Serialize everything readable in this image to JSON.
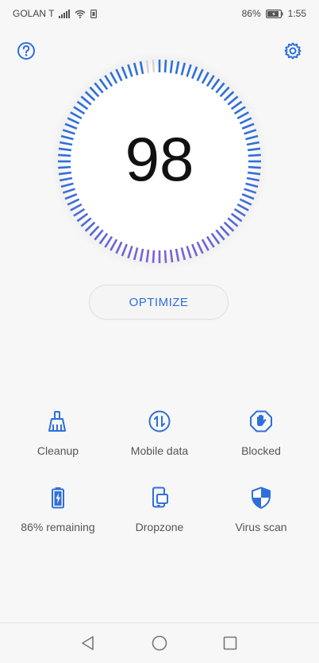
{
  "status_bar": {
    "carrier": "GOLAN T",
    "battery_percent": "86%",
    "time": "1:55"
  },
  "header": {
    "help_icon": "help-circle-icon",
    "settings_icon": "gear-icon"
  },
  "dial": {
    "score": "98",
    "level": 0.98
  },
  "optimize_label": "OPTIMIZE",
  "tools": [
    {
      "label": "Cleanup",
      "icon": "broom-icon"
    },
    {
      "label": "Mobile data",
      "icon": "data-arrows-icon"
    },
    {
      "label": "Blocked",
      "icon": "hand-block-icon"
    },
    {
      "label": "86% remaining",
      "icon": "battery-icon"
    },
    {
      "label": "Dropzone",
      "icon": "dropzone-icon"
    },
    {
      "label": "Virus scan",
      "icon": "shield-icon"
    }
  ],
  "colors": {
    "accent": "#2f6fdb",
    "dial_purple": "#7b62d6",
    "dial_inactive": "#d6d6d6"
  }
}
